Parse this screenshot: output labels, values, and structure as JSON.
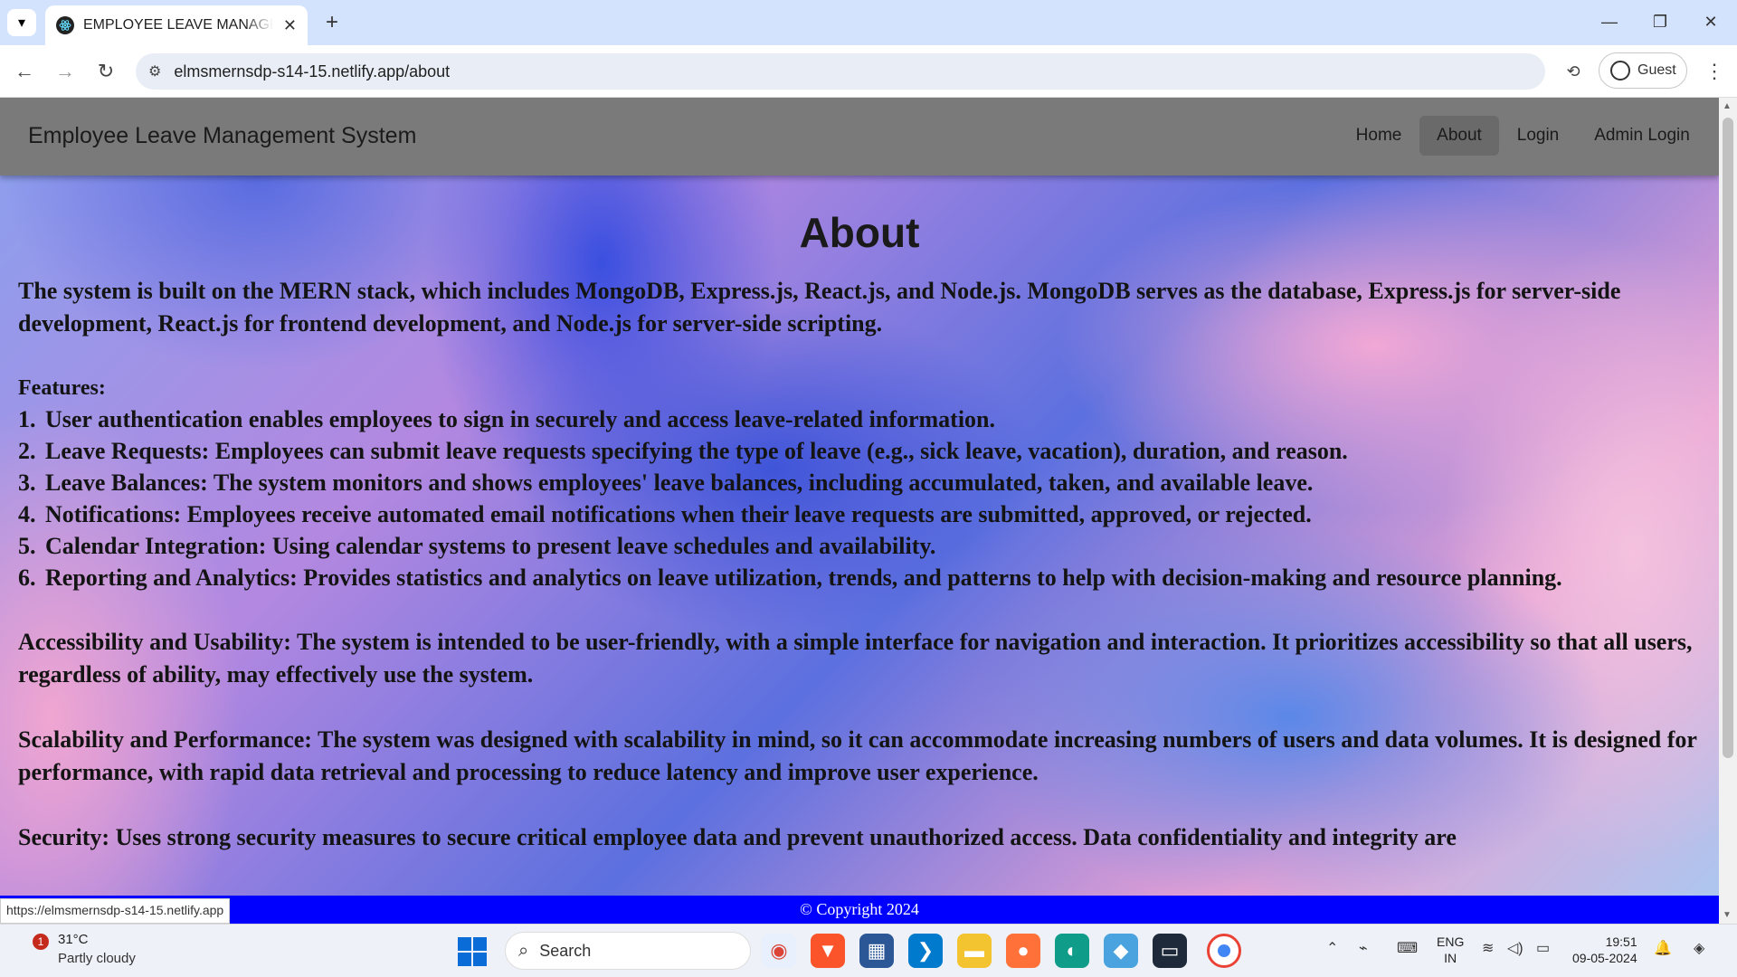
{
  "browser": {
    "tab_title": "EMPLOYEE LEAVE MANAGEMENT",
    "url": "elmsmernsdp-s14-15.netlify.app/about",
    "profile_label": "Guest",
    "status_url": "https://elmsmernsdp-s14-15.netlify.app"
  },
  "navbar": {
    "brand": "Employee Leave Management System",
    "links": [
      "Home",
      "About",
      "Login",
      "Admin Login"
    ],
    "active": "About"
  },
  "page": {
    "title": "About",
    "intro": "The system is built on the MERN stack, which includes MongoDB, Express.js, React.js, and Node.js. MongoDB serves as the database, Express.js for server-side development, React.js for frontend development, and Node.js for server-side scripting.",
    "features_heading": "Features:",
    "features": [
      "User authentication enables employees to sign in securely and access leave-related information.",
      "Leave Requests: Employees can submit leave requests specifying the type of leave (e.g., sick leave, vacation), duration, and reason.",
      "Leave Balances: The system monitors and shows employees' leave balances, including accumulated, taken, and available leave.",
      "Notifications: Employees receive automated email notifications when their leave requests are submitted, approved, or rejected.",
      "Calendar Integration: Using calendar systems to present leave schedules and availability.",
      "Reporting and Analytics: Provides statistics and analytics on leave utilization, trends, and patterns to help with decision-making and resource planning."
    ],
    "feature_numbers": [
      "1.",
      "2.",
      "3.",
      "4.",
      "5.",
      "6."
    ],
    "accessibility": "Accessibility and Usability: The system is intended to be user-friendly, with a simple interface for navigation and interaction. It prioritizes accessibility so that all users, regardless of ability, may effectively use the system.",
    "scalability": "Scalability and Performance: The system was designed with scalability in mind, so it can accommodate increasing numbers of users and data volumes. It is designed for performance, with rapid data retrieval and processing to reduce latency and improve user experience.",
    "security_cutoff": "Security: Uses strong security measures to secure critical employee data and prevent unauthorized access. Data confidentiality and integrity are",
    "footer": "© Copyright 2024"
  },
  "taskbar": {
    "weather_alert": "1",
    "temperature": "31°C",
    "weather_desc": "Partly cloudy",
    "search_label": "Search",
    "lang_line1": "ENG",
    "lang_line2": "IN",
    "time": "19:51",
    "date": "09-05-2024"
  },
  "icons": [
    "tab-list-icon",
    "new-tab-icon",
    "back-icon",
    "forward-icon",
    "reload-icon",
    "site-info-icon",
    "extension-icon",
    "profile-icon",
    "menu-icon",
    "windows-start-icon",
    "search-icon",
    "chevron-up-icon",
    "wifi-icon",
    "volume-icon",
    "battery-icon"
  ]
}
